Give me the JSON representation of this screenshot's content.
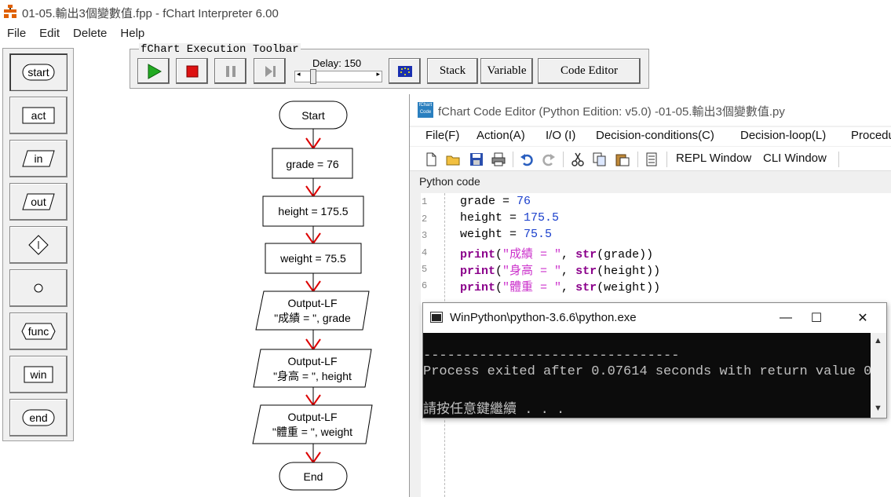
{
  "main_window": {
    "title": "01-05.輸出3個變數值.fpp - fChart Interpreter 6.00",
    "menu": [
      "File",
      "Edit",
      "Delete",
      "Help"
    ]
  },
  "palette": {
    "items": [
      {
        "label": "start",
        "shape": "rounded"
      },
      {
        "label": "act",
        "shape": "rect"
      },
      {
        "label": "in",
        "shape": "parallelogram"
      },
      {
        "label": "out",
        "shape": "parallelogram"
      },
      {
        "label": "",
        "shape": "diamond-icon"
      },
      {
        "label": "",
        "shape": "circle-icon"
      },
      {
        "label": "func",
        "shape": "hexagon"
      },
      {
        "label": "win",
        "shape": "rect"
      },
      {
        "label": "end",
        "shape": "rounded"
      }
    ]
  },
  "exec_toolbar": {
    "legend": "fChart Execution Toolbar",
    "delay_label": "Delay: 150",
    "stack_label": "Stack",
    "variable_label": "Variable",
    "code_editor_label": "Code Editor"
  },
  "flowchart": {
    "start": "Start",
    "steps": [
      "grade = 76",
      "height = 175.5",
      "weight = 75.5"
    ],
    "outputs": [
      {
        "title": "Output-LF",
        "text": "\"成績 = \", grade"
      },
      {
        "title": "Output-LF",
        "text": "\"身高 = \", height"
      },
      {
        "title": "Output-LF",
        "text": "\"體重 = \", weight"
      }
    ],
    "end": "End"
  },
  "code_editor": {
    "title": "fChart Code Editor (Python Edition:  v5.0) -01-05.輸出3個變數值.py",
    "icon_text": "fChart Code",
    "menu": [
      "File(F)",
      "Action(A)",
      "I/O (I)",
      "Decision-conditions(C)",
      "Decision-loop(L)",
      "Procedu"
    ],
    "toolbar_text": [
      "REPL Window",
      "CLI Window"
    ],
    "header": "Python code",
    "line_numbers": [
      "1",
      "2",
      "3",
      "4",
      "5",
      "6"
    ],
    "code": {
      "l1": {
        "var": "grade",
        "op": " = ",
        "val": "76"
      },
      "l2": {
        "var": "height",
        "op": " = ",
        "val": "175.5"
      },
      "l3": {
        "var": "weight",
        "op": " = ",
        "val": "75.5"
      },
      "l4": {
        "kw": "print",
        "p1": "(",
        "s": "\"成績 = \"",
        "c": ", ",
        "fn": "str",
        "arg": "(grade))"
      },
      "l5": {
        "kw": "print",
        "p1": "(",
        "s": "\"身高 = \"",
        "c": ", ",
        "fn": "str",
        "arg": "(height))"
      },
      "l6": {
        "kw": "print",
        "p1": "(",
        "s": "\"體重 = \"",
        "c": ", ",
        "fn": "str",
        "arg": "(weight))"
      }
    }
  },
  "console": {
    "title": "WinPython\\python-3.6.6\\python.exe",
    "controls": [
      "—",
      "☐",
      "✕"
    ],
    "lines": [
      "--------------------------------",
      "Process exited after 0.07614 seconds with return value 0",
      "請按任意鍵繼續 . . ."
    ]
  },
  "colors": {
    "play": "#22aa22",
    "stop": "#dd1111",
    "arrow": "#dd0000",
    "keyword": "#8b008b",
    "string": "#cc33cc",
    "number": "#1a3fcc"
  }
}
